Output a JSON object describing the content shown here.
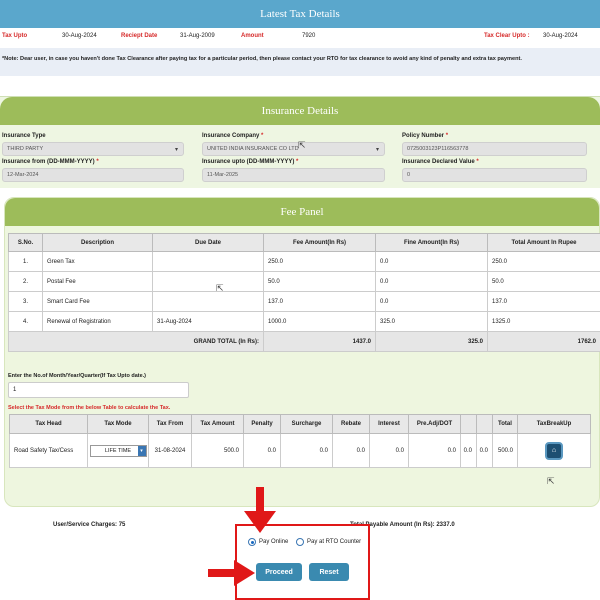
{
  "tax": {
    "title": "Latest Tax Details",
    "tax_upto_label": "Tax Upto",
    "tax_upto_value": "30-Aug-2024",
    "receipt_date_label": "Reciept Date",
    "receipt_date_value": "31-Aug-2009",
    "amount_label": "Amount",
    "amount_value": "7920",
    "tax_clear_label": "Tax Clear Upto :",
    "tax_clear_value": "30-Aug-2024",
    "note": "*Note: Dear user, in case you haven't done Tax Clearance after paying tax for a particular period, then please contact your RTO for tax clearance to avoid any kind of penalty and extra tax payment."
  },
  "insurance": {
    "title": "Insurance Details",
    "type_label": "Insurance Type",
    "type_value": "THIRD PARTY",
    "company_label": "Insurance Company",
    "company_value": "UNITED INDIA INSURANCE CO LTD",
    "policy_label": "Policy Number",
    "policy_value": "0725003123P116563778",
    "from_label": "Insurance from (DD-MMM-YYYY)",
    "from_value": "12-Mar-2024",
    "upto_label": "Insurance upto (DD-MMM-YYYY)",
    "upto_value": "11-Mar-2025",
    "declared_label": "Insurance Declared Value",
    "declared_value": "0"
  },
  "fee": {
    "title": "Fee Panel",
    "headers": [
      "S.No.",
      "Description",
      "Due Date",
      "Fee Amount(In Rs)",
      "Fine Amount(In Rs)",
      "Total Amount In Rupee"
    ],
    "rows": [
      [
        "1.",
        "Green Tax",
        "",
        "250.0",
        "0.0",
        "250.0"
      ],
      [
        "2.",
        "Postal Fee",
        "",
        "50.0",
        "0.0",
        "50.0"
      ],
      [
        "3.",
        "Smart Card Fee",
        "",
        "137.0",
        "0.0",
        "137.0"
      ],
      [
        "4.",
        "Renewal of Registration",
        "31-Aug-2024",
        "1000.0",
        "325.0",
        "1325.0"
      ]
    ],
    "grand_total_label": "GRAND TOTAL (In Rs):",
    "grand_fee": "1437.0",
    "grand_fine": "325.0",
    "grand_total": "1762.0"
  },
  "mode": {
    "enter_label": "Enter the No.of Month/Year/Quarter(If Tax Upto date.)",
    "enter_value": "1",
    "select_note": "Select the Tax Mode from the below Table to calculate the Tax.",
    "headers": [
      "Tax Head",
      "Tax Mode",
      "Tax From",
      "Tax Amount",
      "Penalty",
      "Surcharge",
      "Rebate",
      "Interest",
      "Pre.Adj/DOT",
      "",
      "",
      "Total",
      "TaxBreakUp"
    ],
    "row": {
      "tax_head": "Road Safety Tax/Cess",
      "tax_mode": "LIFE TIME",
      "tax_from": "31-08-2024",
      "tax_amount": "500.0",
      "penalty": "0.0",
      "surcharge": "0.0",
      "rebate": "0.0",
      "interest": "0.0",
      "pre_adj": "0.0",
      "extra1": "0.0",
      "extra2": "0.0",
      "total": "500.0"
    }
  },
  "payment": {
    "user_charges": "User/Service Charges: 75",
    "total_payable": "Total Payable Amount (In Rs): 2337.0",
    "pay_online": "Pay Online",
    "pay_rto": "Pay at RTO Counter",
    "proceed": "Proceed",
    "reset": "Reset"
  },
  "colors": {
    "tax_header": "#5aa7cc",
    "panel_header": "#9dbc5a",
    "annotation": "#e01818",
    "button": "#3a8ab0"
  }
}
